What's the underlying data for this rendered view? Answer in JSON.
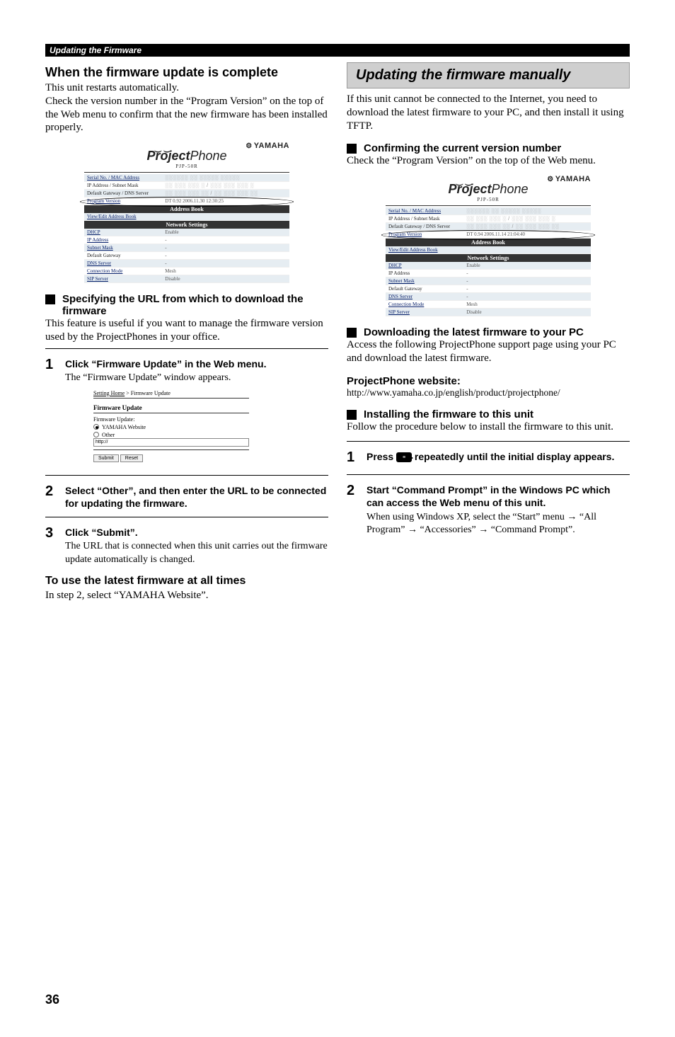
{
  "sectionBar": "Updating the Firmware",
  "left": {
    "h1": "When the firmware update is complete",
    "intro1": "This unit restarts automatically.",
    "intro2": "Check the version number in the “Program Version” on the top of the Web menu to confirm that the new firmware has been installed properly.",
    "sub1": "Specifying the URL from which to download the firmware",
    "sub1Body": "This feature is useful if you want to manage the firmware version used by the ProjectPhones in your office.",
    "step1Title": "Click “Firmware Update” in the Web menu.",
    "step1Body": "The “Firmware Update” window appears.",
    "fwCrumbHome": "Setting Home",
    "fwCrumbSep": " > Firmware Update",
    "fwTitle": "Firmware Update",
    "fwLabel": "Firmware Update:",
    "fwRadio1": "YAMAHA Website",
    "fwRadio2": "Other",
    "fwInput": "http://",
    "fwSubmit": "Submit",
    "fwReset": "Reset",
    "step2Title": "Select “Other”, and then enter the URL to be connected for updating the firmware.",
    "step3Title": "Click “Submit”.",
    "step3Body": "The URL that is connected when this unit carries out the firmware update automatically is changed.",
    "h2Latest": "To use the latest firmware at all times",
    "latestBody": "In step 2, select “YAMAHA Website”.",
    "screenshot": {
      "brand": "YAMAHA",
      "logo1": "Project",
      "logo2": "Phone",
      "model": "PJP-50R",
      "rows": [
        {
          "label": "Serial No. / MAC Address",
          "value": "░░░░░░ ░░ ░░░░░ ░░░░░"
        },
        {
          "label": "IP Address / Subnet Mask",
          "value": "░░ ░░░ ░░░ ░ / ░░░ ░░░ ░░░ ░"
        },
        {
          "label": "Default Gateway / DNS Server",
          "value": "░░ ░░░ ░░░ ░░ / ░░ ░░░ ░░░ ░░"
        },
        {
          "label": "Program Version",
          "value": "DT 0.92 2006.11.30 12:30:25"
        }
      ],
      "addressBookBar": "Address Book",
      "viewEdit": "View/Edit Address Book",
      "netSettingsBar": "Network Settings",
      "netRows": [
        {
          "label": "DHCP",
          "value": "Enable"
        },
        {
          "label": "IP Address",
          "value": "-"
        },
        {
          "label": "Subnet Mask",
          "value": "-"
        },
        {
          "label": "Default Gateway",
          "value": "-"
        },
        {
          "label": "DNS Server",
          "value": "-"
        },
        {
          "label": "Connection Mode",
          "value": "Mesh"
        },
        {
          "label": "SIP Server",
          "value": "Disable"
        }
      ]
    }
  },
  "right": {
    "title": "Updating the firmware manually",
    "intro": "If this unit cannot be connected to the Internet, you need to download the latest firmware to your PC, and then install it using TFTP.",
    "sub1": "Confirming the current version number",
    "sub1Body": "Check the “Program Version” on the top of the Web menu.",
    "screenshot": {
      "brand": "YAMAHA",
      "logo1": "Project",
      "logo2": "Phone",
      "model": "PJP-50R",
      "rows": [
        {
          "label": "Serial No. / MAC Address",
          "value": "░░░░░░ ░░ ░░░░░ ░░░░░"
        },
        {
          "label": "IP Address / Subnet Mask",
          "value": "░░ ░░░ ░░░ ░ / ░░░ ░░░ ░░░ ░"
        },
        {
          "label": "Default Gateway / DNS Server",
          "value": "░░ ░░░ ░░░ ░░ / ░░ ░░░ ░░░ ░░"
        },
        {
          "label": "Program Version",
          "value": "DT 0.94 2006.11.14 21:04:40"
        }
      ],
      "addressBookBar": "Address Book",
      "viewEdit": "View/Edit Address Book",
      "netSettingsBar": "Network Settings",
      "netRows": [
        {
          "label": "DHCP",
          "value": "Enable"
        },
        {
          "label": "IP Address",
          "value": "-"
        },
        {
          "label": "Subnet Mask",
          "value": "-"
        },
        {
          "label": "Default Gateway",
          "value": "-"
        },
        {
          "label": "DNS Server",
          "value": "-"
        },
        {
          "label": "Connection Mode",
          "value": "Mesh"
        },
        {
          "label": "SIP Server",
          "value": "Disable"
        }
      ]
    },
    "sub2": "Downloading the latest firmware to your PC",
    "sub2Body": "Access the following ProjectPhone support page using your PC and download the latest firmware.",
    "websiteH": "ProjectPhone website:",
    "websiteUrl": "http://www.yamaha.co.jp/english/product/projectphone/",
    "sub3": "Installing the firmware to this unit",
    "sub3Body": "Follow the procedure below to install the firmware to this unit.",
    "step1a": "Press ",
    "step1b": " repeatedly until the initial display appears.",
    "step2Title": "Start “Command Prompt” in the Windows PC which can access the Web menu of this unit.",
    "step2Body1": "When using Windows XP, select the “Start” menu ",
    "arrow": "→",
    "step2Body2": " “All Program” ",
    "step2Body3": " “Accessories” ",
    "step2Body4": " “Command Prompt”."
  },
  "pageNum": "36"
}
